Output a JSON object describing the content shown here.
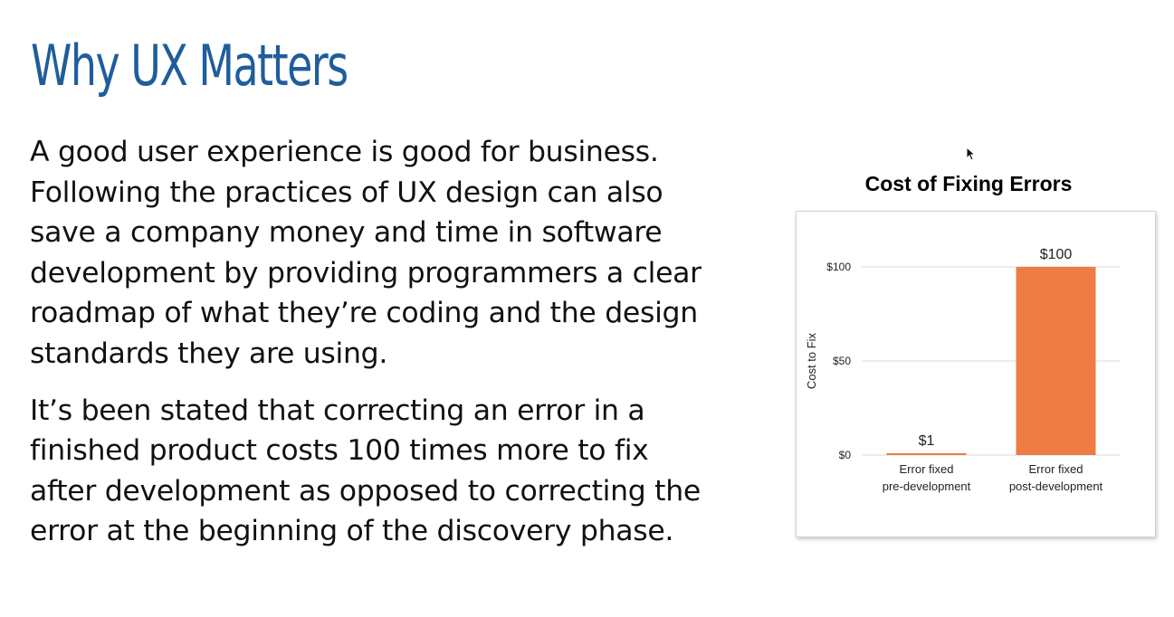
{
  "slide": {
    "title": "Why UX Matters",
    "paragraphs": [
      {
        "lines": [
          "A good user experience is good for business.",
          "Following the practices of UX design can also",
          "save a company money and time in software",
          "development by providing programmers a clear",
          "roadmap of what they’re coding and the design",
          "standards they are using."
        ]
      },
      {
        "lines": [
          "It’s been stated that correcting an error in a",
          "finished product costs 100 times more to fix",
          "after development as opposed to correcting the",
          "error at the beginning of the discovery phase."
        ]
      }
    ]
  },
  "colors": {
    "title": "#1f5d9b",
    "body_text": "#111111",
    "bar": "#ed7d45",
    "gridline": "#d9d9d9"
  },
  "chart_data": {
    "type": "bar",
    "title": "Cost of Fixing Errors",
    "ylabel": "Cost to Fix",
    "xlabel": "",
    "categories": [
      [
        "Error fixed",
        "pre-development"
      ],
      [
        "Error fixed",
        "post-development"
      ]
    ],
    "values": [
      1,
      100
    ],
    "data_labels": [
      "$1",
      "$100"
    ],
    "yticks": [
      {
        "value": 0,
        "label": "$0"
      },
      {
        "value": 50,
        "label": "$50"
      },
      {
        "value": 100,
        "label": "$100"
      }
    ],
    "ylim": [
      0,
      100
    ],
    "grid": true,
    "legend": "none"
  }
}
